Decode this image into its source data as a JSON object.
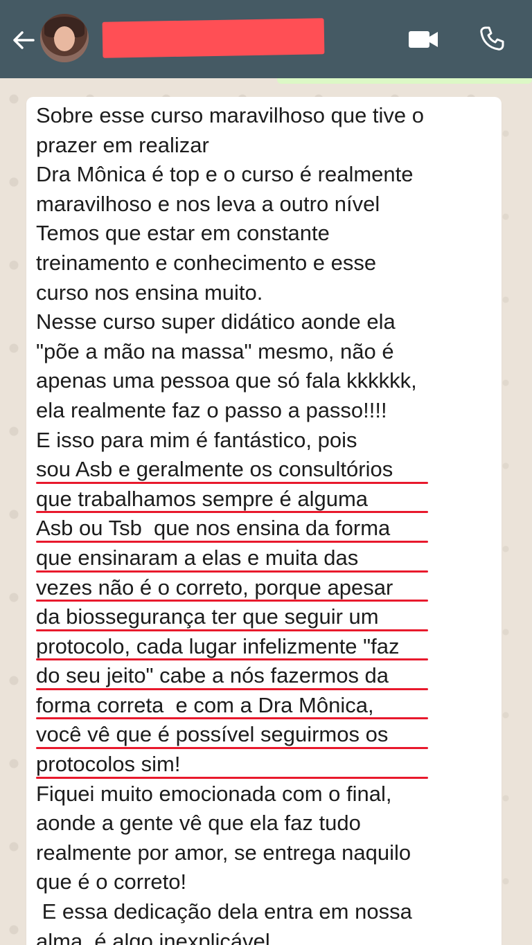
{
  "header": {
    "contact_name": "",
    "back_icon": "arrow-left-icon",
    "video_icon": "video-camera-icon",
    "call_icon": "phone-icon",
    "background_color": "#455a64",
    "redaction_color": "#ff4f55"
  },
  "message": {
    "underline_color": "#e8192c",
    "lines": [
      "Sobre esse curso maravilhoso que tive o",
      "prazer em realizar",
      "Dra Mônica é top e o curso é realmente",
      "maravilhoso e nos leva a outro nível",
      "Temos que estar em constante",
      "treinamento e conhecimento e esse",
      "curso nos ensina muito.",
      "Nesse curso super didático aonde ela",
      "\"põe a mão na massa\" mesmo, não é",
      "apenas uma pessoa que só fala kkkkkk,",
      "ela realmente faz o passo a passo!!!!",
      "E isso para mim é fantástico, pois",
      "sou Asb e geralmente os consultórios",
      "que trabalhamos sempre é alguma",
      "Asb ou Tsb  que nos ensina da forma",
      "que ensinaram a elas e muita das",
      "vezes não é o correto, porque apesar",
      "da biossegurança ter que seguir um",
      "protocolo, cada lugar infelizmente \"faz",
      "do seu jeito\" cabe a nós fazermos da",
      "forma correta  e com a Dra Mônica,",
      "você vê que é possível seguirmos os",
      "protocolos sim!",
      "Fiquei muito emocionada com o final,",
      "aonde a gente vê que ela faz tudo",
      "realmente por amor, se entrega naquilo",
      "que é o correto!",
      " E essa dedicação dela entra em nossa",
      "alma, é algo inexplicável"
    ]
  }
}
